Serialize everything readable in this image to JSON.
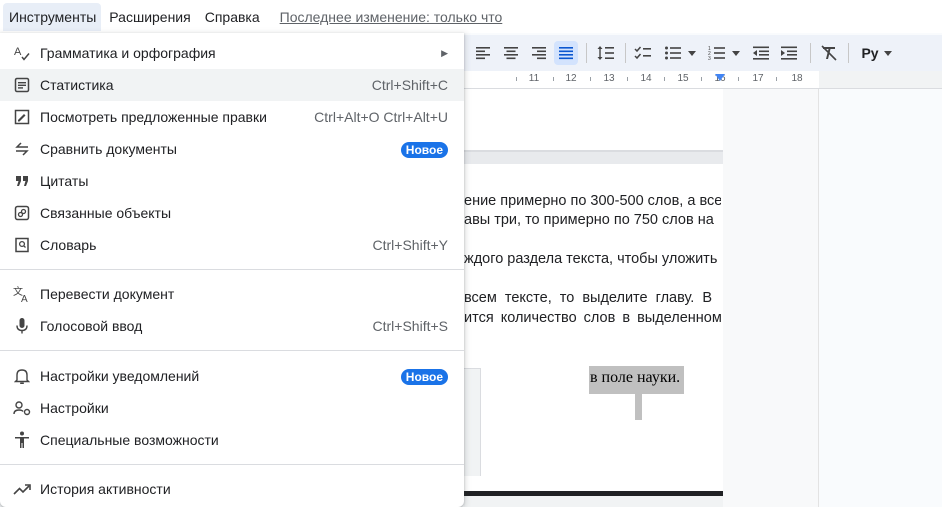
{
  "menubar": {
    "items": [
      "Инструменты",
      "Расширения",
      "Справка"
    ],
    "last_edit": "Последнее изменение: только что"
  },
  "menu": {
    "items": [
      {
        "icon": "spellcheck-icon",
        "label": "Грамматика и орфография",
        "submenu": true
      },
      {
        "icon": "word-count-icon",
        "label": "Статистика",
        "shortcut": "Ctrl+Shift+C",
        "hovered": true
      },
      {
        "icon": "review-edits-icon",
        "label": "Посмотреть предложенные правки",
        "shortcut": "Ctrl+Alt+O Ctrl+Alt+U"
      },
      {
        "icon": "compare-icon",
        "label": "Сравнить документы",
        "badge": "Новое"
      },
      {
        "icon": "quote-icon",
        "label": "Цитаты"
      },
      {
        "icon": "linked-objects-icon",
        "label": "Связанные объекты"
      },
      {
        "icon": "dictionary-icon",
        "label": "Словарь",
        "shortcut": "Ctrl+Shift+Y"
      },
      {
        "icon": "translate-icon",
        "label": "Перевести документ"
      },
      {
        "icon": "microphone-icon",
        "label": "Голосовой ввод",
        "shortcut": "Ctrl+Shift+S"
      },
      {
        "icon": "bell-icon",
        "label": "Настройки уведомлений",
        "badge": "Новое"
      },
      {
        "icon": "preferences-icon",
        "label": "Настройки"
      },
      {
        "icon": "accessibility-icon",
        "label": "Специальные возможности"
      },
      {
        "icon": "activity-icon",
        "label": "История активности"
      }
    ]
  },
  "toolbar": {
    "style_label": "Pу"
  },
  "ruler": {
    "numbers": [
      "11",
      "12",
      "13",
      "14",
      "15",
      "16",
      "17",
      "18"
    ]
  },
  "document": {
    "lines": [
      "ение примерно по 300-500 слов, а все",
      "авы три, то примерно по 750 слов на",
      "ждого раздела текста, чтобы уложить",
      "всем тексте, то выделите главу. В",
      "ится количество слов в выделенном"
    ],
    "image_caption": "в поле науки."
  },
  "colors": {
    "accent": "#1a73e8",
    "menu_hover": "#f1f3f4",
    "active_menu": "#e8eef7",
    "toolbar_bg": "#eef2f9"
  }
}
